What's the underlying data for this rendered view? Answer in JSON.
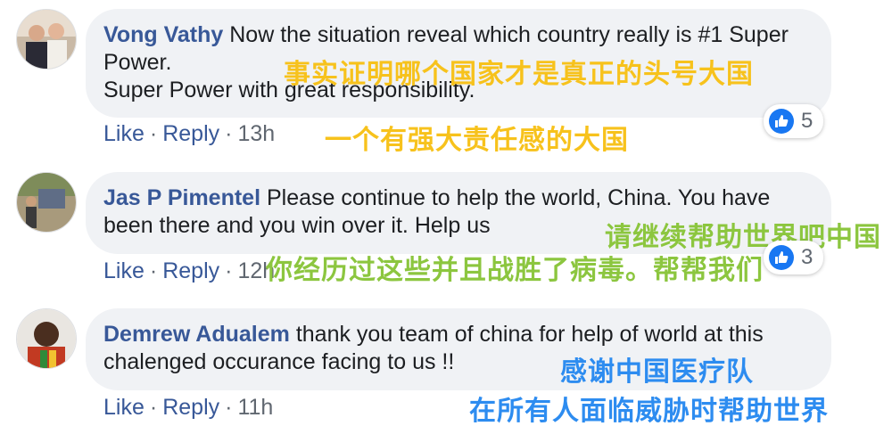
{
  "comments": [
    {
      "author": "Vong Vathy",
      "text": "Now the situation reveal which country really is #1 Super Power.",
      "text2": "Super Power with great responsibility.",
      "like_label": "Like",
      "reply_label": "Reply",
      "separator": "·",
      "time": "13h",
      "reactions": "5"
    },
    {
      "author": "Jas P Pimentel",
      "text": "Please continue to help the world, China. You have been there and you win over it. Help us",
      "like_label": "Like",
      "reply_label": "Reply",
      "separator": "·",
      "time": "12h",
      "reactions": "3"
    },
    {
      "author": "Demrew Adualem",
      "text": "thank you team of china for help of world at this chalenged occurance facing to us !!",
      "like_label": "Like",
      "reply_label": "Reply",
      "separator": "·",
      "time": "11h"
    }
  ],
  "overlays": {
    "c1_line1": "事实证明哪个国家才是真正的头号大国",
    "c1_line2": "一个有强大责任感的大国",
    "c2_line1": "请继续帮助世界吧中国",
    "c2_line2": "你经历过这些并且战胜了病毒。帮帮我们",
    "c3_line1": "感谢中国医疗队",
    "c3_line2": "在所有人面临威胁时帮助世界"
  },
  "colors": {
    "author_link": "#385898",
    "bubble_bg": "#f0f2f5",
    "like_blue": "#1877f2",
    "overlay_yellow": "#f7c21c",
    "overlay_green": "#8cc63f",
    "overlay_blue": "#2d8cf0"
  },
  "icons": [
    "avatar",
    "thumbs-up-icon"
  ]
}
